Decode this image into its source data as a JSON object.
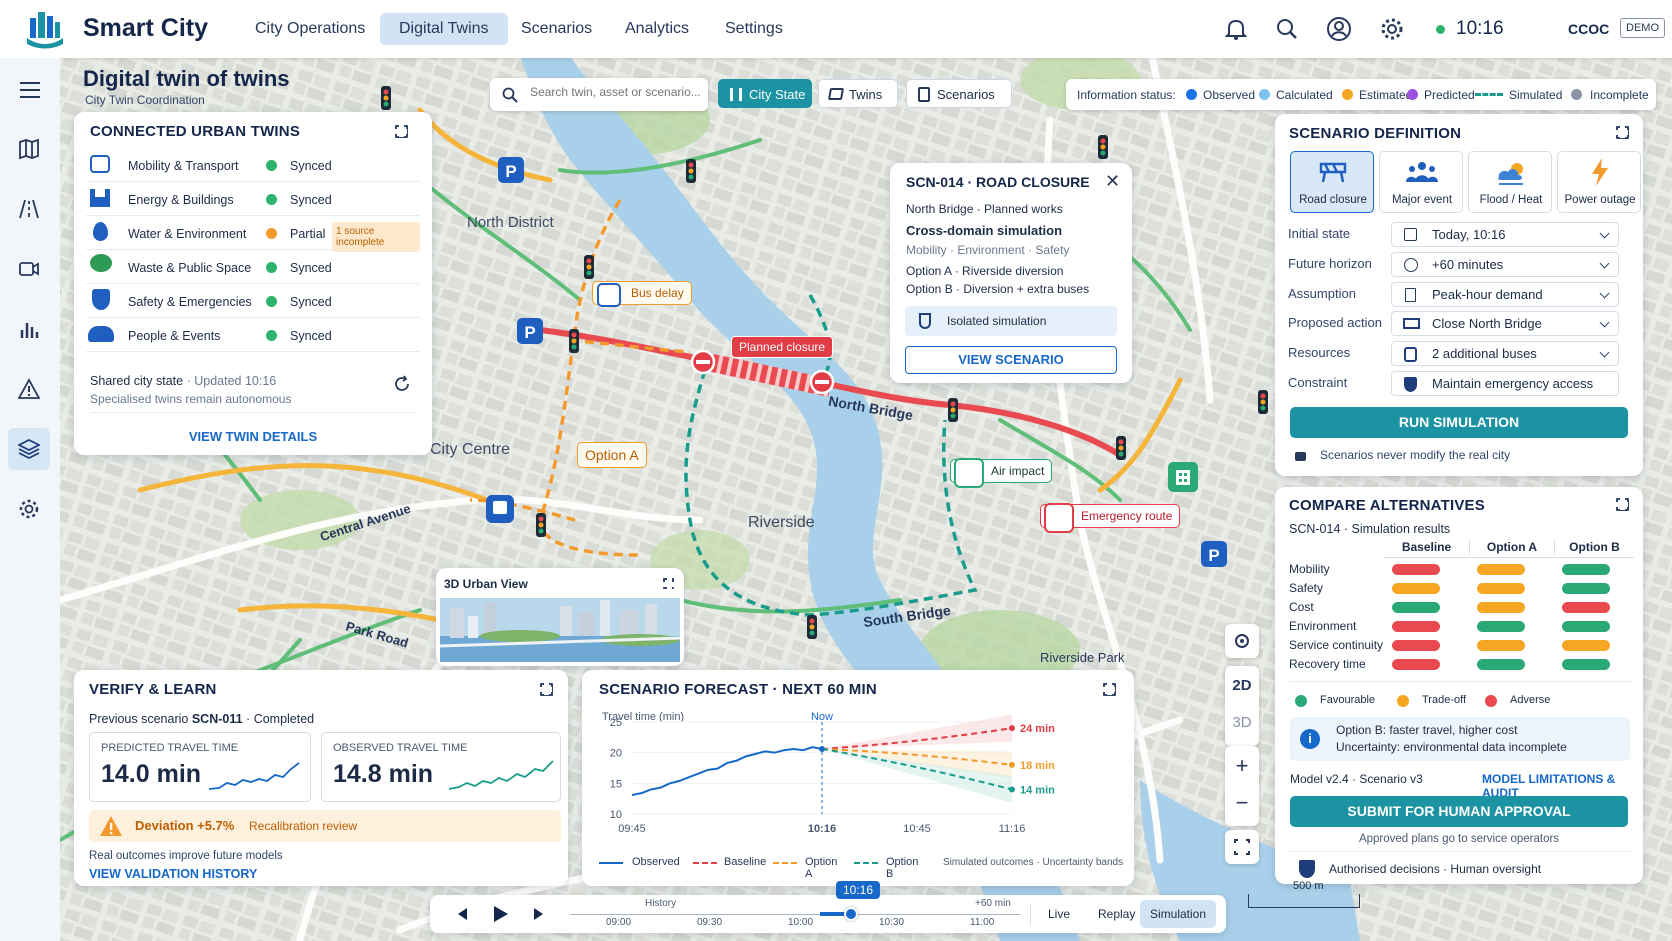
{
  "app": {
    "title": "Smart City",
    "user": "CCOC",
    "mode_badge": "DEMO",
    "time": "10:16"
  },
  "nav": [
    {
      "label": "City Operations"
    },
    {
      "label": "Digital Twins"
    },
    {
      "label": "Scenarios"
    },
    {
      "label": "Analytics"
    },
    {
      "label": "Settings"
    }
  ],
  "page": {
    "title": "Digital twin of twins",
    "subtitle": "City Twin Coordination"
  },
  "search": {
    "placeholder": "Search twin, asset or scenario..."
  },
  "view_tabs": [
    {
      "label": "City State"
    },
    {
      "label": "Twins"
    },
    {
      "label": "Scenarios"
    }
  ],
  "info_status": {
    "label": "Information status:",
    "items": [
      {
        "label": "Observed",
        "color": "#1a73e8"
      },
      {
        "label": "Calculated",
        "color": "#7fc2ef"
      },
      {
        "label": "Estimated",
        "color": "#f5a623"
      },
      {
        "label": "Predicted",
        "color": "#9b51e0"
      },
      {
        "label": "Simulated",
        "color": "#1a9c8c"
      },
      {
        "label": "Incomplete",
        "color": "#8a94a3"
      }
    ]
  },
  "connected": {
    "title": "Connected Urban Twins",
    "items": [
      {
        "label": "Mobility & Transport",
        "status": "Synced",
        "color": "#2db36b",
        "note": ""
      },
      {
        "label": "Energy & Buildings",
        "status": "Synced",
        "color": "#2db36b",
        "note": ""
      },
      {
        "label": "Water & Environment",
        "status": "Partial",
        "color": "#f29a2e",
        "note": "1 source incomplete"
      },
      {
        "label": "Waste & Public Space",
        "status": "Synced",
        "color": "#2db36b",
        "note": ""
      },
      {
        "label": "Safety & Emergencies",
        "status": "Synced",
        "color": "#2db36b",
        "note": ""
      },
      {
        "label": "People & Events",
        "status": "Synced",
        "color": "#2db36b",
        "note": ""
      }
    ],
    "shared": "Shared city state",
    "updated": "Updated 10:16",
    "autonomy": "Specialised twins remain autonomous",
    "link": "VIEW TWIN DETAILS"
  },
  "popup": {
    "code": "SCN-014",
    "title": "ROAD CLOSURE",
    "location": "North Bridge",
    "works": "Planned works",
    "subtitle": "Cross-domain simulation",
    "domains": [
      "Mobility",
      "Environment",
      "Safety"
    ],
    "optA_label": "Option A",
    "optA": "Riverside diversion",
    "optB_label": "Option B",
    "optB": "Diversion + extra buses",
    "isolated": "Isolated simulation",
    "button": "VIEW SCENARIO"
  },
  "map_labels": {
    "north_district": "North District",
    "city_centre": "City Centre",
    "riverside": "Riverside",
    "north_bridge": "North Bridge",
    "south_bridge": "South Bridge",
    "central_avenue": "Central Avenue",
    "park_road": "Park Road",
    "riverside_park": "Riverside Park",
    "bus_delay": "Bus delay",
    "planned_closure": "Planned closure",
    "option_a": "Option A",
    "air_impact": "Air impact",
    "emergency_route": "Emergency route",
    "urban_view": "3D Urban View",
    "scale": "500 m"
  },
  "scenario_def": {
    "title": "Scenario Definition",
    "types": [
      {
        "label": "Road closure"
      },
      {
        "label": "Major event"
      },
      {
        "label": "Flood / Heat"
      },
      {
        "label": "Power outage"
      }
    ],
    "fields": [
      {
        "label": "Initial state",
        "value": "Today, 10:16"
      },
      {
        "label": "Future horizon",
        "value": "+60 minutes"
      },
      {
        "label": "Assumption",
        "value": "Peak-hour demand"
      },
      {
        "label": "Proposed action",
        "value": "Close North Bridge"
      },
      {
        "label": "Resources",
        "value": "2 additional buses"
      },
      {
        "label": "Constraint",
        "value": "Maintain emergency access"
      }
    ],
    "run": "RUN SIMULATION",
    "note": "Scenarios never modify the real city"
  },
  "compare": {
    "title": "Compare Alternatives",
    "subtitle_code": "SCN-014",
    "subtitle": "Simulation results",
    "columns": [
      "Baseline",
      "Option A",
      "Option B"
    ],
    "rows": [
      {
        "label": "Mobility",
        "vals": [
          "#e84a4f",
          "#f5a623",
          "#2aa876"
        ]
      },
      {
        "label": "Safety",
        "vals": [
          "#f5a623",
          "#f5a623",
          "#2aa876"
        ]
      },
      {
        "label": "Cost",
        "vals": [
          "#2aa876",
          "#f5a623",
          "#e84a4f"
        ]
      },
      {
        "label": "Environment",
        "vals": [
          "#e84a4f",
          "#2aa876",
          "#2aa876"
        ]
      },
      {
        "label": "Service continuity",
        "vals": [
          "#e84a4f",
          "#f5a623",
          "#f5a623"
        ]
      },
      {
        "label": "Recovery time",
        "vals": [
          "#e84a4f",
          "#2aa876",
          "#2aa876"
        ]
      }
    ],
    "legend": [
      {
        "label": "Favourable",
        "color": "#2aa876"
      },
      {
        "label": "Trade-off",
        "color": "#f5a623"
      },
      {
        "label": "Adverse",
        "color": "#e84a4f"
      }
    ],
    "info1": "Option B: faster travel, higher cost",
    "info2": "Uncertainty: environmental data incomplete",
    "model": "Model v2.4",
    "scenario_ver": "Scenario v3",
    "limits": "MODEL LIMITATIONS & AUDIT",
    "submit": "SUBMIT FOR HUMAN APPROVAL",
    "approved": "Approved plans go to service operators",
    "authorised": "Authorised decisions",
    "oversight": "Human oversight"
  },
  "verify": {
    "title": "Verify & Learn",
    "prev": "Previous scenario",
    "code": "SCN-011",
    "state": "Completed",
    "pred_label": "PREDICTED TRAVEL TIME",
    "pred_val": "14.0 min",
    "obs_label": "OBSERVED TRAVEL TIME",
    "obs_val": "14.8 min",
    "deviation": "Deviation +5.7%",
    "recal": "Recalibration review",
    "note": "Real outcomes improve future models",
    "link": "VIEW VALIDATION HISTORY"
  },
  "forecast": {
    "title": "Scenario Forecast · Next 60 min"
  },
  "chart_data": {
    "type": "line",
    "ylabel": "Travel time (min)",
    "ylim": [
      10,
      25
    ],
    "yticks": [
      25,
      20,
      15,
      10
    ],
    "xticks": [
      "09:45",
      "10:16",
      "10:45",
      "11:16"
    ],
    "now_label": "Now",
    "observed": [
      [
        0,
        13.1
      ],
      [
        3,
        13.4
      ],
      [
        6,
        14.0
      ],
      [
        9,
        14.3
      ],
      [
        12,
        15.0
      ],
      [
        15,
        15.4
      ],
      [
        18,
        16.0
      ],
      [
        21,
        16.6
      ],
      [
        24,
        17.2
      ],
      [
        27,
        17.4
      ],
      [
        30,
        18.3
      ],
      [
        33,
        18.7
      ],
      [
        36,
        19.4
      ],
      [
        39,
        19.8
      ],
      [
        42,
        20.2
      ],
      [
        45,
        20.0
      ],
      [
        48,
        20.4
      ],
      [
        51,
        20.6
      ],
      [
        54,
        20.4
      ],
      [
        57,
        20.9
      ],
      [
        60,
        20.6
      ]
    ],
    "now_x": 60,
    "x_end": 120,
    "series": [
      {
        "name": "Baseline",
        "end": 24,
        "color": "#e23c46",
        "label": "24 min"
      },
      {
        "name": "Option A",
        "end": 18,
        "color": "#f29a2e",
        "label": "18 min"
      },
      {
        "name": "Option B",
        "end": 14,
        "color": "#1a9c8c",
        "label": "14 min"
      }
    ],
    "legend": [
      "Observed",
      "Baseline",
      "Option A",
      "Option B"
    ],
    "legend_note": "Simulated outcomes · Uncertainty bands"
  },
  "timeline": {
    "history": "History",
    "future": "+60 min",
    "now": "10:16",
    "ticks": [
      "09:00",
      "09:30",
      "10:00",
      "10:30",
      "11:00"
    ],
    "modes": [
      "Live",
      "Replay",
      "Simulation"
    ]
  },
  "map_controls": {
    "view2d": "2D",
    "view3d": "3D"
  }
}
